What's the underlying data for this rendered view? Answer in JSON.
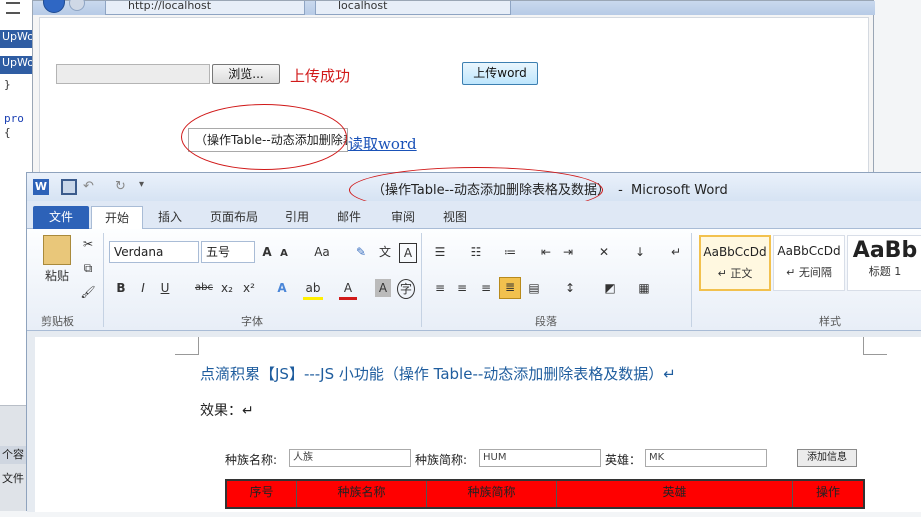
{
  "editor": {
    "tab1": "UpWo",
    "tab2": "UpWo",
    "code1": "}",
    "code2": "pro",
    "code3": "{",
    "bottom_tab": "个容",
    "bottom_item": "文件"
  },
  "browser": {
    "address": "http://localhost",
    "tab_title": "localhost",
    "browse_label": "浏览...",
    "status": "上传成功",
    "upload_label": "上传word",
    "field_value": "（操作Table--动态添加删除表格及数据）",
    "read_link": "读取word"
  },
  "word": {
    "title_doc": "（操作Table--动态添加删除表格及数据）",
    "title_sep": "-",
    "title_app": "Microsoft Word",
    "tabs": [
      "文件",
      "开始",
      "插入",
      "页面布局",
      "引用",
      "邮件",
      "审阅",
      "视图"
    ],
    "groups": [
      "剪贴板",
      "字体",
      "段落",
      "样式"
    ],
    "paste_label": "粘贴",
    "font_name": "Verdana",
    "font_size": "五号",
    "styles": [
      {
        "sample": "AaBbCcDd",
        "name": "↵ 正文"
      },
      {
        "sample": "AaBbCcDd",
        "name": "↵ 无间隔"
      },
      {
        "sample": "AaBb",
        "name": "标题 1"
      }
    ]
  },
  "document": {
    "heading": "点滴积累【JS】---JS 小功能（操作 Table--动态添加删除表格及数据）↵",
    "effect": "效果：↵",
    "demo": {
      "label_name": "种族名称:",
      "value_name": "人族",
      "label_short": "种族简称:",
      "value_short": "HUM",
      "label_hero": "英雄：",
      "value_hero": "MK",
      "add_button": "添加信息",
      "columns": [
        "序号",
        "种族名称",
        "种族简称",
        "英雄",
        "操作"
      ]
    }
  },
  "colors": {
    "status_red": "#d11a1a",
    "link_blue": "#1a52b8",
    "word_blue": "#2d62b8",
    "heading_blue": "#1f5d9e",
    "table_red": "#ff0000"
  }
}
